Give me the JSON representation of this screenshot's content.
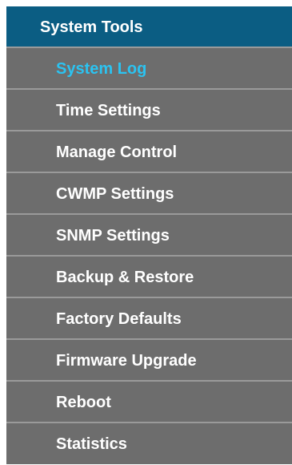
{
  "menu": {
    "header": "System Tools",
    "items": [
      {
        "label": "System Log",
        "active": true
      },
      {
        "label": "Time Settings",
        "active": false
      },
      {
        "label": "Manage Control",
        "active": false
      },
      {
        "label": "CWMP Settings",
        "active": false
      },
      {
        "label": "SNMP Settings",
        "active": false
      },
      {
        "label": "Backup & Restore",
        "active": false
      },
      {
        "label": "Factory Defaults",
        "active": false
      },
      {
        "label": "Firmware Upgrade",
        "active": false
      },
      {
        "label": "Reboot",
        "active": false
      },
      {
        "label": "Statistics",
        "active": false
      }
    ]
  },
  "colors": {
    "header_bg": "#0b5d83",
    "item_bg": "#6d6d6d",
    "divider": "#9a9a9a",
    "text": "#ffffff",
    "active_text": "#2bc3f1"
  }
}
